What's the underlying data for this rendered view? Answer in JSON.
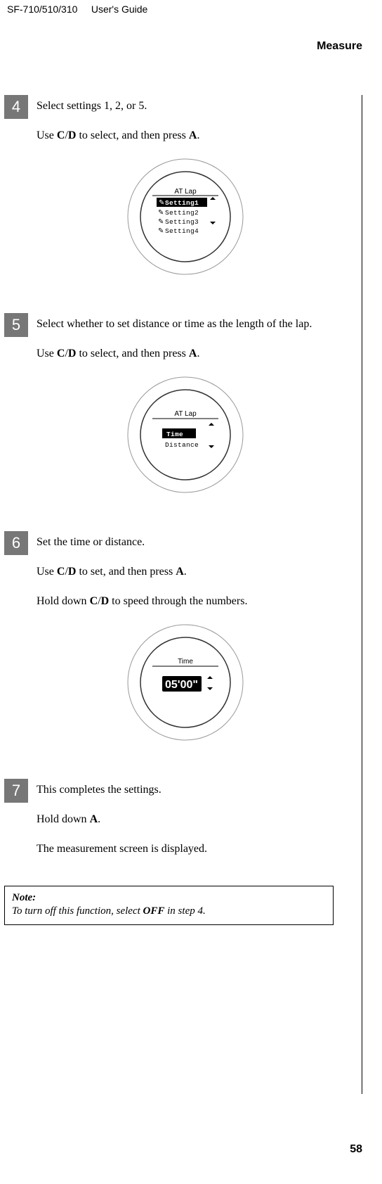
{
  "header": {
    "model": "SF-710/510/310",
    "guide": "User's Guide"
  },
  "chapter": "Measure",
  "steps": {
    "s4": {
      "num": "4",
      "p1": "Select settings 1, 2, or 5.",
      "p2a": "Use ",
      "p2b": "C",
      "p2c": "/",
      "p2d": "D",
      "p2e": " to select, and then press ",
      "p2f": "A",
      "p2g": "."
    },
    "s5": {
      "num": "5",
      "p1": "Select whether to set distance or time as the length of the lap.",
      "p2a": "Use ",
      "p2b": "C",
      "p2c": "/",
      "p2d": "D",
      "p2e": " to select, and then press ",
      "p2f": "A",
      "p2g": "."
    },
    "s6": {
      "num": "6",
      "p1": "Set the time or distance.",
      "p2a": "Use ",
      "p2b": "C",
      "p2c": "/",
      "p2d": "D",
      "p2e": " to set, and then press ",
      "p2f": "A",
      "p2g": ".",
      "p3a": "Hold down ",
      "p3b": "C",
      "p3c": "/",
      "p3d": "D",
      "p3e": " to speed through the numbers."
    },
    "s7": {
      "num": "7",
      "p1": "This completes the settings.",
      "p2a": "Hold down ",
      "p2b": "A",
      "p2c": ".",
      "p3": "The measurement screen is displayed."
    }
  },
  "watch4": {
    "title": "AT Lap",
    "row1": "Setting1",
    "row2": "Setting2",
    "row3": "Setting3",
    "row4": "Setting4"
  },
  "watch5": {
    "title": "AT Lap",
    "row1": "Time",
    "row2": "Distance"
  },
  "watch6": {
    "title": "Time",
    "value": "05'00\""
  },
  "note": {
    "label": "Note:",
    "bodyA": "To turn off this function, select ",
    "bodyB": "OFF",
    "bodyC": " in step 4."
  },
  "pageNum": "58"
}
